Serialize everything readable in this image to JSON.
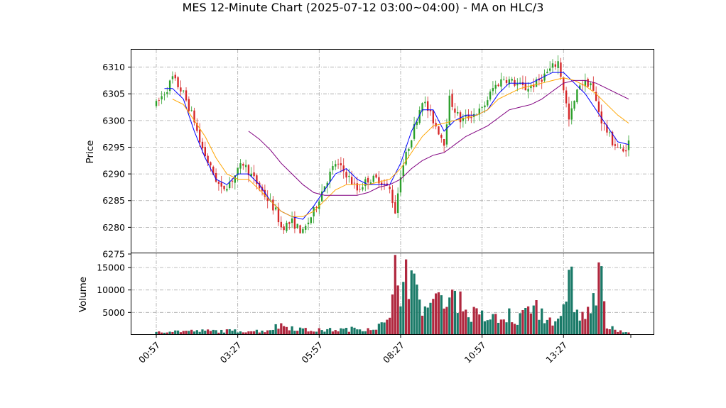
{
  "chart_data": {
    "type": "candlestick",
    "title": "MES 12-Minute Chart (2025-07-12 03:00~04:00) - MA on HLC/3",
    "price_panel": {
      "ylabel": "Price",
      "ylim": [
        6275,
        6313
      ],
      "yticks": [
        "6275",
        "6280",
        "6285",
        "6290",
        "6295",
        "6300",
        "6305",
        "6310"
      ],
      "grid": true
    },
    "volume_panel": {
      "ylabel": "Volume",
      "ylim": [
        0,
        18000
      ],
      "yticks": [
        "5000",
        "10000",
        "15000"
      ],
      "grid": true
    },
    "xticks": [
      "00:57",
      "03:27",
      "05:57",
      "08:27",
      "10:57",
      "13:27"
    ],
    "up_color": "#2ca02c",
    "down_color": "#d62728",
    "vol_up_color": "#1a7a68",
    "vol_down_color": "#b0283f",
    "ma_series": [
      {
        "color": "#0000ff",
        "values": [
          [
            3,
            6306
          ],
          [
            6,
            6306
          ],
          [
            10,
            6304
          ],
          [
            14,
            6298
          ],
          [
            18,
            6293
          ],
          [
            22,
            6289
          ],
          [
            26,
            6288
          ],
          [
            30,
            6290
          ],
          [
            34,
            6290
          ],
          [
            38,
            6288
          ],
          [
            42,
            6285
          ],
          [
            46,
            6283
          ],
          [
            50,
            6282
          ],
          [
            54,
            6281.5
          ],
          [
            58,
            6284
          ],
          [
            62,
            6287
          ],
          [
            66,
            6290
          ],
          [
            70,
            6291
          ],
          [
            74,
            6289
          ],
          [
            78,
            6288
          ],
          [
            82,
            6288
          ],
          [
            86,
            6288
          ],
          [
            90,
            6292
          ],
          [
            94,
            6298
          ],
          [
            98,
            6302
          ],
          [
            102,
            6302
          ],
          [
            106,
            6298
          ],
          [
            110,
            6300
          ],
          [
            114,
            6301
          ],
          [
            118,
            6301
          ],
          [
            122,
            6302
          ],
          [
            126,
            6305
          ],
          [
            130,
            6307
          ],
          [
            134,
            6307
          ],
          [
            138,
            6307
          ],
          [
            142,
            6308
          ],
          [
            146,
            6309
          ],
          [
            150,
            6309
          ],
          [
            154,
            6307
          ],
          [
            158,
            6305
          ],
          [
            162,
            6302
          ],
          [
            166,
            6299
          ],
          [
            170,
            6296
          ],
          [
            174,
            6295.5
          ]
        ]
      },
      {
        "color": "#ffa500",
        "values": [
          [
            6,
            6304
          ],
          [
            10,
            6303
          ],
          [
            14,
            6300
          ],
          [
            18,
            6297
          ],
          [
            22,
            6293
          ],
          [
            26,
            6290
          ],
          [
            30,
            6289
          ],
          [
            34,
            6289
          ],
          [
            38,
            6287
          ],
          [
            42,
            6285
          ],
          [
            46,
            6283
          ],
          [
            50,
            6282
          ],
          [
            54,
            6282
          ],
          [
            58,
            6283
          ],
          [
            62,
            6285
          ],
          [
            66,
            6287
          ],
          [
            70,
            6288
          ],
          [
            74,
            6288
          ],
          [
            78,
            6288
          ],
          [
            82,
            6288.5
          ],
          [
            86,
            6289
          ],
          [
            90,
            6291
          ],
          [
            94,
            6294
          ],
          [
            98,
            6297
          ],
          [
            102,
            6299
          ],
          [
            106,
            6299.5
          ],
          [
            110,
            6300
          ],
          [
            114,
            6300.5
          ],
          [
            118,
            6301
          ],
          [
            122,
            6302
          ],
          [
            126,
            6304
          ],
          [
            130,
            6305
          ],
          [
            134,
            6306
          ],
          [
            138,
            6306.5
          ],
          [
            142,
            6307
          ],
          [
            146,
            6307.5
          ],
          [
            150,
            6308
          ],
          [
            154,
            6307.5
          ],
          [
            158,
            6306.5
          ],
          [
            162,
            6305
          ],
          [
            166,
            6303
          ],
          [
            170,
            6301
          ],
          [
            174,
            6299.5
          ]
        ]
      },
      {
        "color": "#800080",
        "values": [
          [
            34,
            6298
          ],
          [
            38,
            6296.5
          ],
          [
            42,
            6294.5
          ],
          [
            46,
            6292
          ],
          [
            50,
            6290
          ],
          [
            54,
            6288
          ],
          [
            58,
            6286.5
          ],
          [
            62,
            6286
          ],
          [
            66,
            6286
          ],
          [
            70,
            6286
          ],
          [
            74,
            6286
          ],
          [
            78,
            6286.5
          ],
          [
            82,
            6287.5
          ],
          [
            86,
            6288
          ],
          [
            90,
            6289
          ],
          [
            94,
            6291
          ],
          [
            98,
            6292.5
          ],
          [
            102,
            6293.5
          ],
          [
            106,
            6294
          ],
          [
            110,
            6295.5
          ],
          [
            114,
            6297
          ],
          [
            118,
            6298
          ],
          [
            122,
            6299
          ],
          [
            126,
            6300.5
          ],
          [
            130,
            6302
          ],
          [
            134,
            6302.5
          ],
          [
            138,
            6303
          ],
          [
            142,
            6304
          ],
          [
            146,
            6305.5
          ],
          [
            150,
            6307
          ],
          [
            154,
            6307.5
          ],
          [
            158,
            6307.5
          ],
          [
            162,
            6307
          ],
          [
            166,
            6306
          ],
          [
            170,
            6305
          ],
          [
            174,
            6304
          ]
        ]
      }
    ],
    "ohlc_keypoints": [
      [
        0,
        6303
      ],
      [
        4,
        6306
      ],
      [
        6,
        6308
      ],
      [
        10,
        6305
      ],
      [
        14,
        6300
      ],
      [
        16,
        6296
      ],
      [
        20,
        6291
      ],
      [
        24,
        6287
      ],
      [
        28,
        6289
      ],
      [
        32,
        6292
      ],
      [
        36,
        6289
      ],
      [
        40,
        6286
      ],
      [
        44,
        6283
      ],
      [
        46,
        6280
      ],
      [
        50,
        6281
      ],
      [
        54,
        6279
      ],
      [
        58,
        6283
      ],
      [
        62,
        6288
      ],
      [
        66,
        6292
      ],
      [
        70,
        6290
      ],
      [
        74,
        6287
      ],
      [
        78,
        6289
      ],
      [
        82,
        6289
      ],
      [
        86,
        6287
      ],
      [
        88,
        6283
      ],
      [
        90,
        6290
      ],
      [
        94,
        6297
      ],
      [
        98,
        6304
      ],
      [
        102,
        6300
      ],
      [
        106,
        6296
      ],
      [
        108,
        6304
      ],
      [
        112,
        6300
      ],
      [
        116,
        6301
      ],
      [
        120,
        6302
      ],
      [
        124,
        6306
      ],
      [
        128,
        6308
      ],
      [
        132,
        6307
      ],
      [
        136,
        6306
      ],
      [
        140,
        6307
      ],
      [
        144,
        6309
      ],
      [
        148,
        6311
      ],
      [
        150,
        6306
      ],
      [
        152,
        6300
      ],
      [
        156,
        6307
      ],
      [
        160,
        6307
      ],
      [
        164,
        6300
      ],
      [
        168,
        6296
      ],
      [
        172,
        6294
      ],
      [
        174,
        6296
      ]
    ],
    "volume_keypoints": [
      [
        0,
        800
      ],
      [
        20,
        900
      ],
      [
        40,
        900
      ],
      [
        46,
        2200
      ],
      [
        56,
        1000
      ],
      [
        70,
        1200
      ],
      [
        80,
        1600
      ],
      [
        86,
        2800
      ],
      [
        88,
        17500
      ],
      [
        90,
        11000
      ],
      [
        92,
        16500
      ],
      [
        96,
        8000
      ],
      [
        100,
        6000
      ],
      [
        106,
        8000
      ],
      [
        110,
        9500
      ],
      [
        114,
        5000
      ],
      [
        120,
        4000
      ],
      [
        130,
        3000
      ],
      [
        136,
        4500
      ],
      [
        140,
        5500
      ],
      [
        144,
        3500
      ],
      [
        150,
        3000
      ],
      [
        152,
        14500
      ],
      [
        154,
        5000
      ],
      [
        158,
        4000
      ],
      [
        160,
        5500
      ],
      [
        164,
        15000
      ],
      [
        166,
        2000
      ],
      [
        170,
        700
      ],
      [
        174,
        800
      ]
    ],
    "volume_spikes": [
      [
        88,
        17800
      ],
      [
        92,
        16800
      ],
      [
        89,
        11000
      ],
      [
        91,
        11800
      ],
      [
        152,
        14500
      ],
      [
        153,
        15200
      ],
      [
        164,
        15300
      ],
      [
        165,
        7500
      ],
      [
        110,
        9800
      ],
      [
        104,
        9500
      ],
      [
        136,
        6000
      ],
      [
        130,
        5900
      ],
      [
        150,
        6800
      ]
    ]
  }
}
